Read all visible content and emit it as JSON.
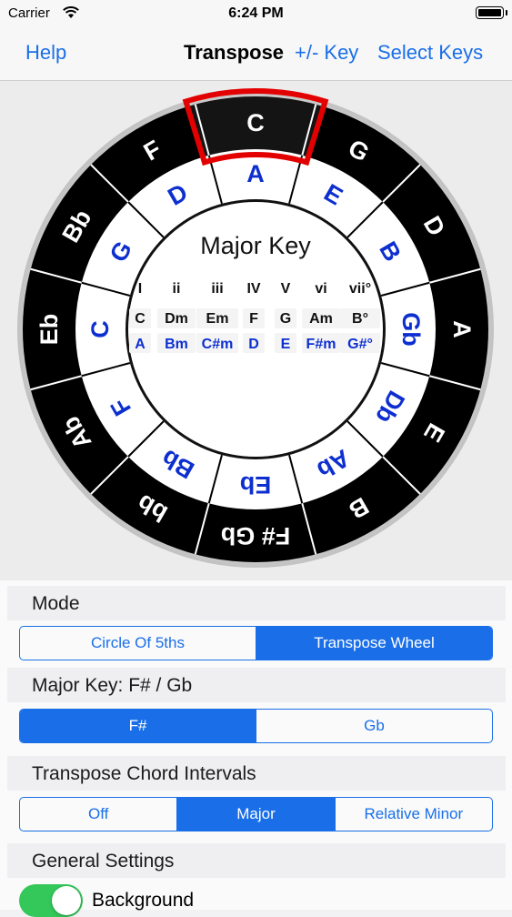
{
  "status_bar": {
    "carrier": "Carrier",
    "time": "6:24 PM"
  },
  "nav": {
    "help": "Help",
    "title": "Transpose",
    "key_adjust": "+/- Key",
    "select_keys": "Select Keys"
  },
  "wheel": {
    "outer_ring": [
      "C",
      "G",
      "D",
      "A",
      "E",
      "B",
      "F# Gb",
      "bb",
      "Ab",
      "Eb",
      "Bb",
      "F"
    ],
    "inner_ring": [
      "A",
      "E",
      "B",
      "Gb",
      "Db",
      "Ab",
      "Eb",
      "Bb",
      "F",
      "C",
      "G",
      "D"
    ],
    "center_title": "Major Key",
    "degrees": [
      "I",
      "ii",
      "iii",
      "IV",
      "V",
      "vi",
      "vii°"
    ],
    "chords_row1": [
      "C",
      "Dm",
      "Em",
      "F",
      "G",
      "Am",
      "B°"
    ],
    "chords_row2": [
      "A",
      "Bm",
      "C#m",
      "D",
      "E",
      "F#m",
      "G#°"
    ],
    "colors": {
      "black": "#000000",
      "white": "#ffffff",
      "blue": "#0d2fd0",
      "selector": "#e30000"
    }
  },
  "settings": {
    "mode_header": "Mode",
    "mode_options": [
      "Circle Of 5ths",
      "Transpose Wheel"
    ],
    "mode_selected": "Transpose Wheel",
    "key_header": "Major Key: F# / Gb",
    "key_options": [
      "F#",
      "Gb"
    ],
    "key_selected": "F#",
    "intervals_header": "Transpose Chord Intervals",
    "interval_options": [
      "Off",
      "Major",
      "Relative Minor"
    ],
    "interval_selected": "Major",
    "general_header": "General Settings",
    "background_label": "Background",
    "background_on": true,
    "accent_color": "#1a6fe8",
    "toggle_color": "#34c759"
  }
}
